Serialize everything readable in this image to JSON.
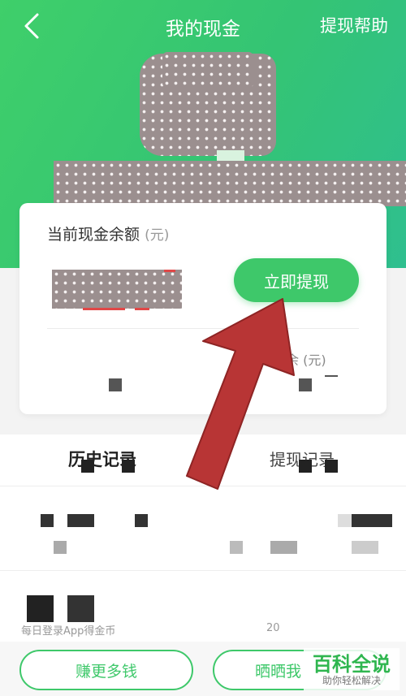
{
  "nav": {
    "title": "我的现金",
    "help": "提现帮助"
  },
  "card": {
    "balance_label": "当前现金余额",
    "balance_unit": "(元)",
    "withdraw_button": "立即提现",
    "secondary_label": "余 (元)"
  },
  "tabs": {
    "history": "历史记录",
    "withdraw_records": "提现记录"
  },
  "records": {
    "row_text": "每日登录App得金币",
    "row_value": "20"
  },
  "bottom": {
    "earn_button": "赚更多钱",
    "share_button": "晒晒我"
  },
  "watermark": {
    "main": "百科全说",
    "sub": "助你轻松解决"
  },
  "colors": {
    "brand_green": "#3ec86a",
    "arrow_red": "#b83535"
  }
}
